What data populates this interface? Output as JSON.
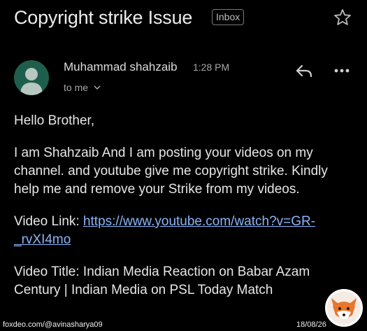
{
  "email": {
    "subject": "Copyright strike Issue",
    "label_badge": "Inbox",
    "sender": {
      "name": "Muhammad shahzaib",
      "time": "1:28 PM",
      "recipient": "to me"
    },
    "body": {
      "greeting": "Hello Brother,",
      "paragraph": "I am Shahzaib And I am posting your videos on my channel. and youtube give me copyright strike. Kindly help me and remove your Strike from my videos.",
      "video_link_label": "Video Link: ",
      "video_link_url": "https://www.youtube.com/watch?v=GR-_rvXI4mo",
      "video_title": "Video Title: Indian Media Reaction on Babar Azam Century | Indian Media on PSL Today Match"
    }
  },
  "watermark": {
    "text": "foxdeo.com/@avinasharya09",
    "date": "18/08/26"
  },
  "colors": {
    "background": "#000000",
    "avatar": "#1f5e4d",
    "link": "#8ab4f8"
  },
  "icons": [
    "star-icon",
    "reply-icon",
    "more-options-icon",
    "chevron-down-icon",
    "avatar-person-icon",
    "fox-logo-icon"
  ]
}
